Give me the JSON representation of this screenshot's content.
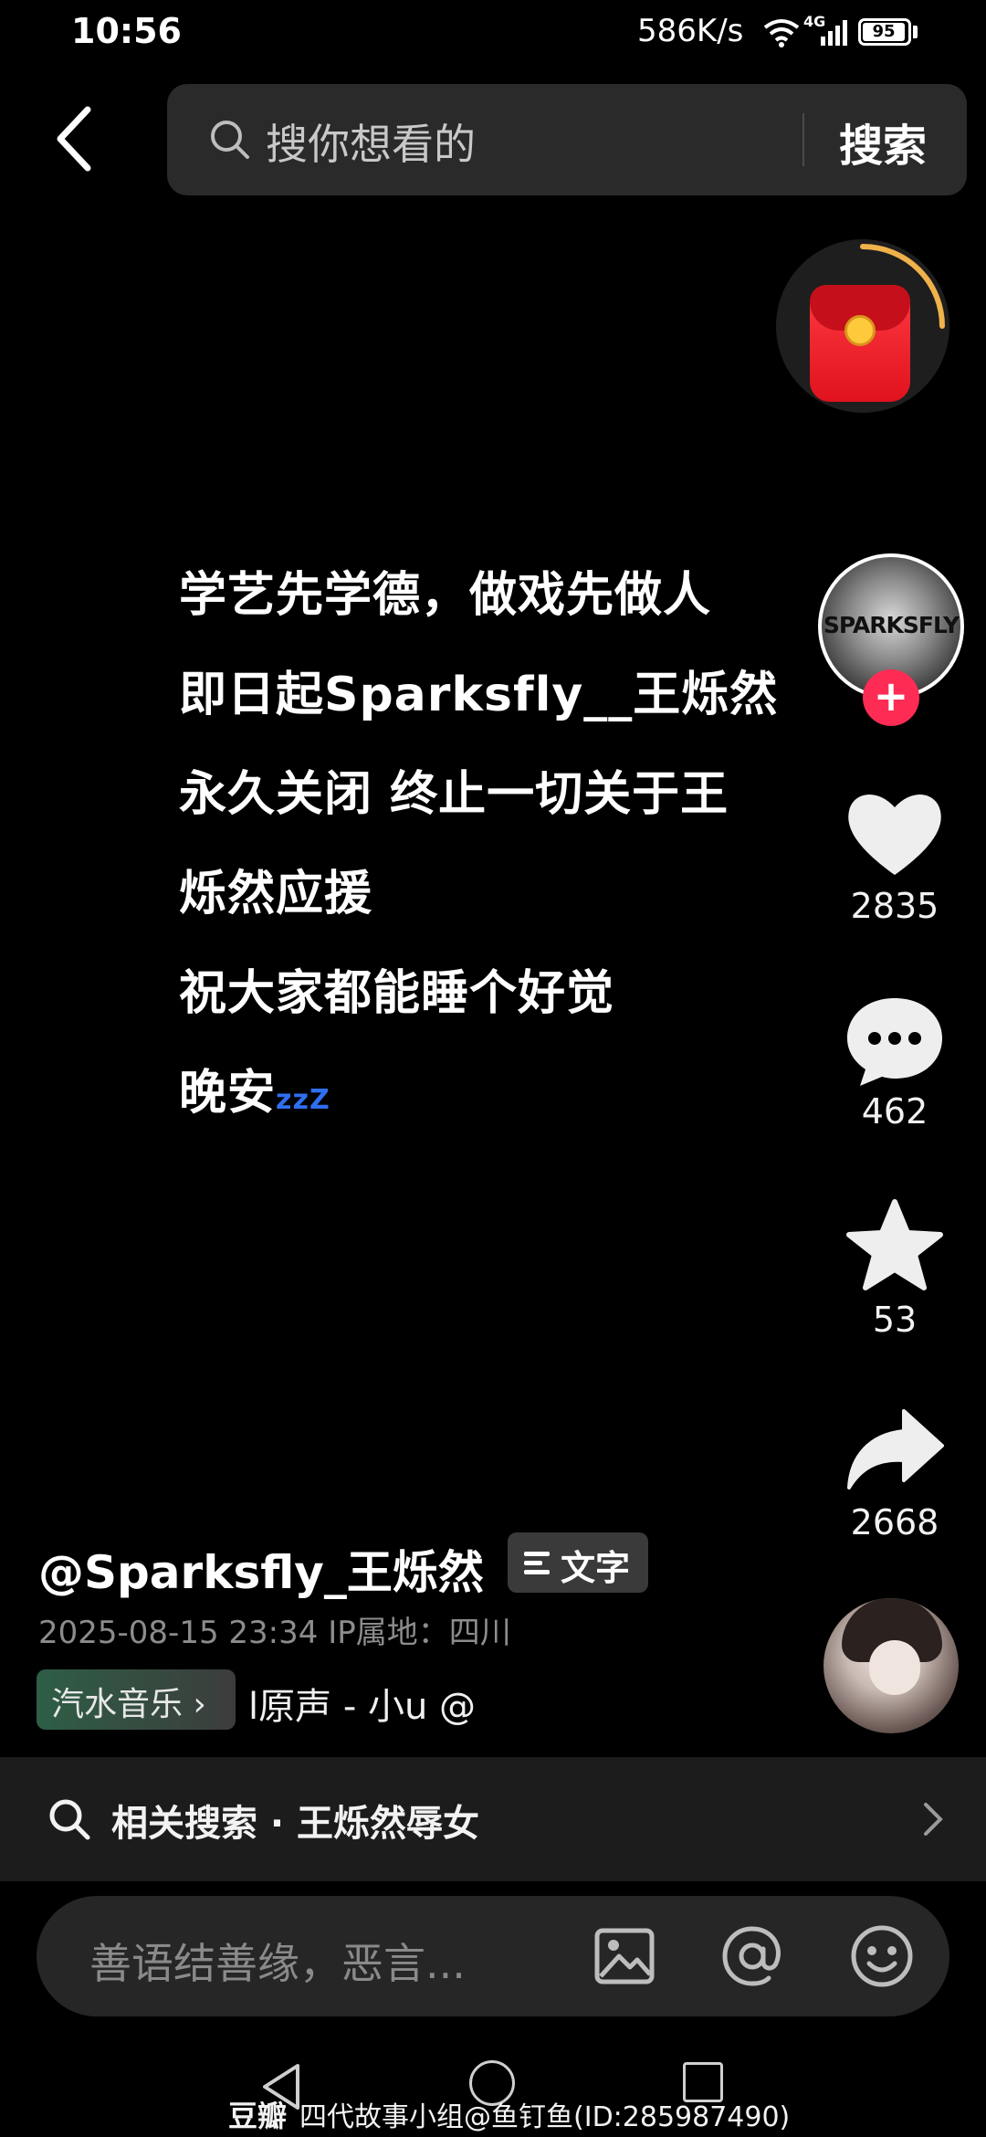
{
  "status_bar": {
    "time": "10:56",
    "net_speed": "586K/s",
    "network": "4G",
    "battery": "95"
  },
  "search": {
    "placeholder": "搜你想看的",
    "button": "搜索"
  },
  "caption": {
    "lines": [
      "学艺先学德，做戏先做人",
      "即日起Sparksfly__王烁然",
      "永久关闭 终止一切关于王",
      "烁然应援",
      "祝大家都能睡个好觉",
      "晚安"
    ],
    "sleep_emoji": "zzZ"
  },
  "author": {
    "avatar_text": "SPARKSFLY",
    "follow_symbol": "+"
  },
  "actions": {
    "likes": "2835",
    "comments": "462",
    "favorites": "53",
    "shares": "2668"
  },
  "post": {
    "username": "@Sparksfly_王烁然",
    "text_badge": "文字",
    "datetime": "2025-08-15 23:34",
    "ip_location": "IP属地：四川",
    "music_badge": "汽水音乐 ›",
    "music_text": "l原声 - 小u    @"
  },
  "related": {
    "label": "相关搜索 · 王烁然辱女"
  },
  "comment_input": {
    "placeholder": "善语结善缘，恶言..."
  },
  "watermark": {
    "brand": "豆瓣",
    "text": "四代故事小组@鱼钉鱼(ID:285987490)"
  },
  "colors": {
    "accent_red": "#fe2c55",
    "background": "#000000",
    "zz_blue": "#2f6ef0"
  }
}
